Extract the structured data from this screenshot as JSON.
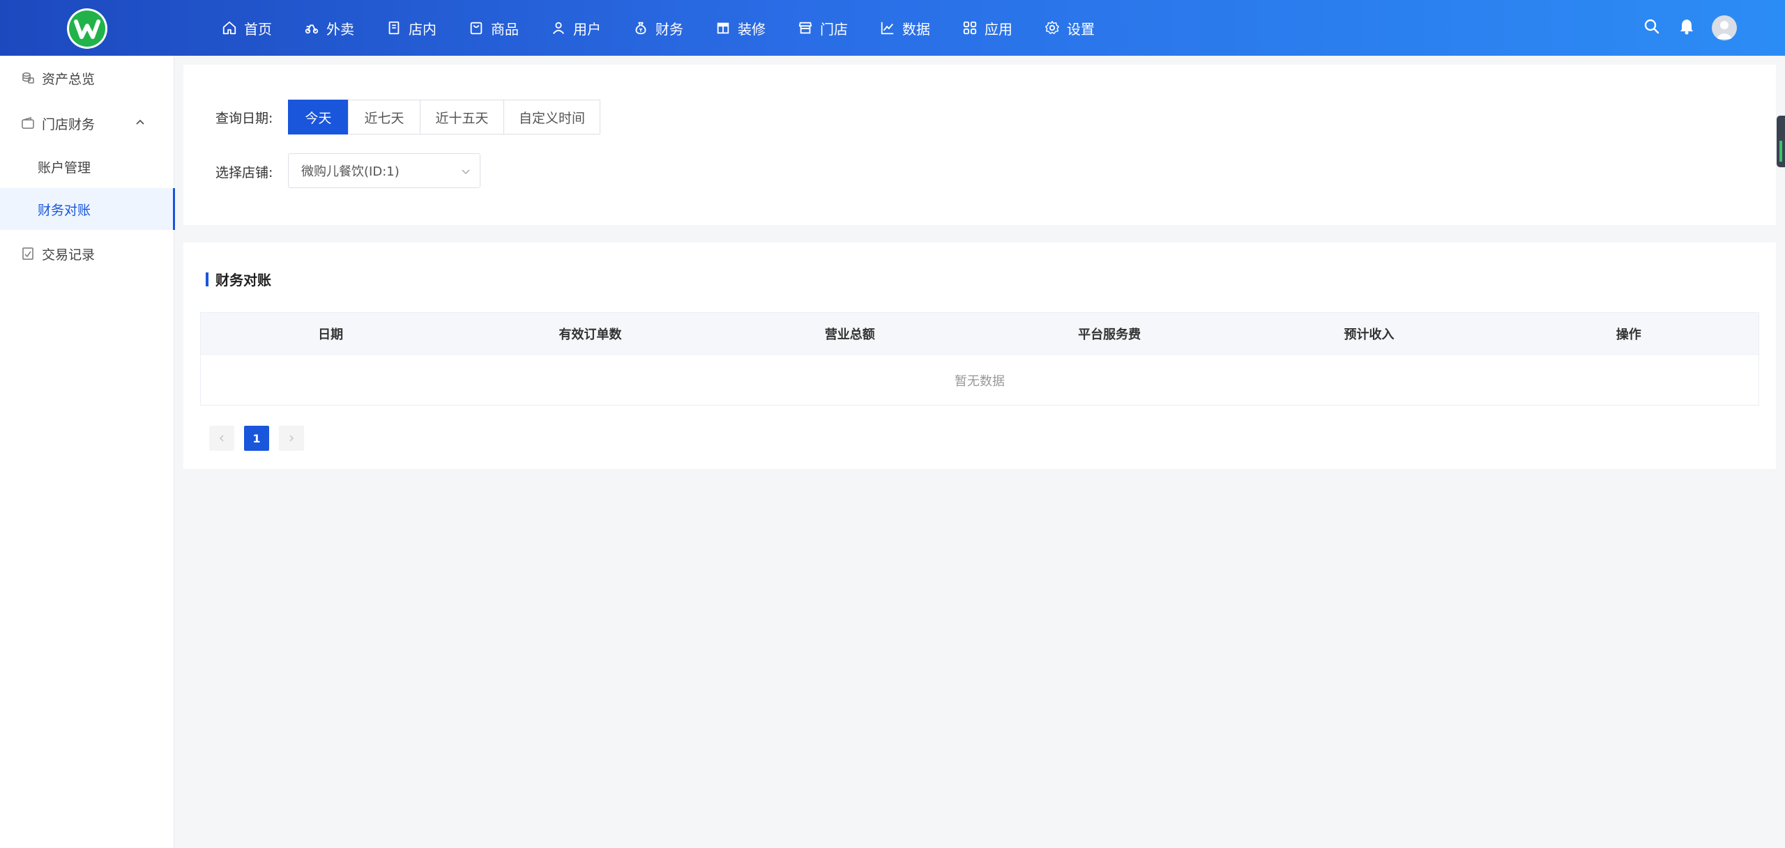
{
  "nav": {
    "items": [
      {
        "label": "首页",
        "icon": "home-icon"
      },
      {
        "label": "外卖",
        "icon": "scooter-icon"
      },
      {
        "label": "店内",
        "icon": "qr-icon"
      },
      {
        "label": "商品",
        "icon": "bag-icon"
      },
      {
        "label": "用户",
        "icon": "user-icon"
      },
      {
        "label": "财务",
        "icon": "money-bag-icon"
      },
      {
        "label": "装修",
        "icon": "store-decor-icon"
      },
      {
        "label": "门店",
        "icon": "shop-icon"
      },
      {
        "label": "数据",
        "icon": "chart-icon"
      },
      {
        "label": "应用",
        "icon": "apps-icon"
      },
      {
        "label": "设置",
        "icon": "gear-icon"
      }
    ]
  },
  "sidebar": {
    "items": [
      {
        "label": "资产总览",
        "icon": "coins-icon"
      },
      {
        "label": "门店财务",
        "icon": "wallet-icon"
      },
      {
        "label": "账户管理"
      },
      {
        "label": "财务对账"
      },
      {
        "label": "交易记录",
        "icon": "receipt-icon"
      }
    ]
  },
  "filter": {
    "date_label": "查询日期:",
    "date_options": [
      "今天",
      "近七天",
      "近十五天",
      "自定义时间"
    ],
    "selected_date": "今天",
    "store_label": "选择店铺:",
    "store_value": "微购儿餐饮(ID:1)"
  },
  "list": {
    "title": "财务对账",
    "columns": [
      "日期",
      "有效订单数",
      "营业总额",
      "平台服务费",
      "预计收入",
      "操作"
    ],
    "empty_text": "暂无数据",
    "page": "1"
  },
  "colors": {
    "primary": "#1a56db",
    "header_start": "#1d49bf",
    "header_end": "#2c8cf5",
    "logo_green": "#21b34a"
  }
}
